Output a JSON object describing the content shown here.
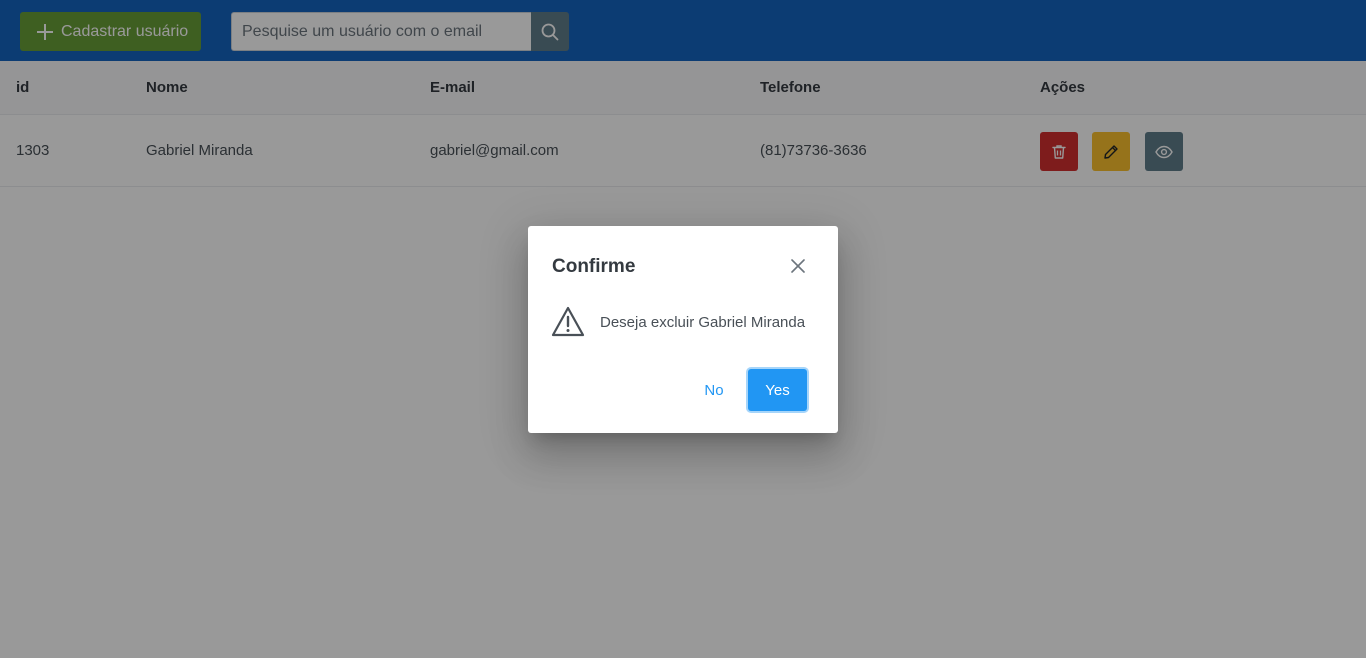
{
  "toolbar": {
    "add_button_label": "Cadastrar usuário",
    "search_placeholder": "Pesquise um usuário com o email",
    "search_value": "",
    "colors": {
      "background": "#1565c0",
      "add_button": "#689f38",
      "search_button": "#607d8b"
    },
    "icons": {
      "add": "plus-icon",
      "search": "search-icon"
    }
  },
  "table": {
    "headers": {
      "id": "id",
      "name": "Nome",
      "email": "E-mail",
      "phone": "Telefone",
      "actions": "Ações"
    },
    "rows": [
      {
        "id": "1303",
        "name": "Gabriel Miranda",
        "email": "gabriel@gmail.com",
        "phone": "(81)73736-3636"
      }
    ],
    "actions": {
      "delete_icon": "trash-icon",
      "edit_icon": "pencil-icon",
      "view_icon": "eye-icon",
      "colors": {
        "delete": "#d32f2f",
        "edit": "#fbc02d",
        "view": "#607d8b"
      }
    }
  },
  "dialog": {
    "title": "Confirme",
    "message": "Deseja excluir Gabriel Miranda",
    "no_label": "No",
    "yes_label": "Yes",
    "icons": {
      "close": "close-icon",
      "warning": "warning-triangle-icon"
    },
    "colors": {
      "primary": "#2196f3"
    }
  }
}
